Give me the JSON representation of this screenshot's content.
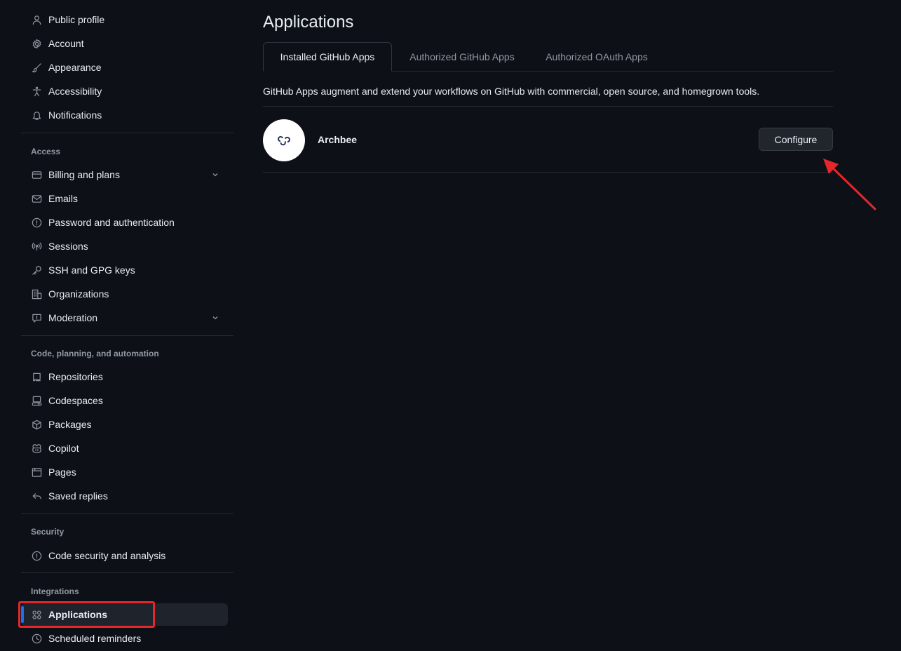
{
  "sidebar": {
    "items_top": [
      {
        "label": "Public profile",
        "icon": "person-icon"
      },
      {
        "label": "Account",
        "icon": "gear-icon"
      },
      {
        "label": "Appearance",
        "icon": "paintbrush-icon"
      },
      {
        "label": "Accessibility",
        "icon": "accessibility-icon"
      },
      {
        "label": "Notifications",
        "icon": "bell-icon"
      }
    ],
    "access": {
      "title": "Access",
      "items": [
        {
          "label": "Billing and plans",
          "icon": "credit-card-icon",
          "expandable": true
        },
        {
          "label": "Emails",
          "icon": "mail-icon"
        },
        {
          "label": "Password and authentication",
          "icon": "shield-lock-icon"
        },
        {
          "label": "Sessions",
          "icon": "broadcast-icon"
        },
        {
          "label": "SSH and GPG keys",
          "icon": "key-icon"
        },
        {
          "label": "Organizations",
          "icon": "organization-icon"
        },
        {
          "label": "Moderation",
          "icon": "report-icon",
          "expandable": true
        }
      ]
    },
    "code": {
      "title": "Code, planning, and automation",
      "items": [
        {
          "label": "Repositories",
          "icon": "repo-icon"
        },
        {
          "label": "Codespaces",
          "icon": "codespaces-icon"
        },
        {
          "label": "Packages",
          "icon": "package-icon"
        },
        {
          "label": "Copilot",
          "icon": "copilot-icon"
        },
        {
          "label": "Pages",
          "icon": "browser-icon"
        },
        {
          "label": "Saved replies",
          "icon": "reply-icon"
        }
      ]
    },
    "security": {
      "title": "Security",
      "items": [
        {
          "label": "Code security and analysis",
          "icon": "shield-icon"
        }
      ]
    },
    "integrations": {
      "title": "Integrations",
      "items": [
        {
          "label": "Applications",
          "icon": "apps-icon",
          "active": true
        },
        {
          "label": "Scheduled reminders",
          "icon": "clock-icon"
        }
      ]
    }
  },
  "main": {
    "title": "Applications",
    "tabs": [
      {
        "label": "Installed GitHub Apps",
        "selected": true
      },
      {
        "label": "Authorized GitHub Apps",
        "selected": false
      },
      {
        "label": "Authorized OAuth Apps",
        "selected": false
      }
    ],
    "description": "GitHub Apps augment and extend your workflows on GitHub with commercial, open source, and homegrown tools.",
    "apps": [
      {
        "name": "Archbee",
        "action_label": "Configure",
        "icon": "archbee-logo-icon"
      }
    ]
  },
  "annotations": {
    "highlight_color": "#e5262b",
    "arrow_color": "#e5262b"
  },
  "colors": {
    "background": "#0d1117",
    "text": "#e6edf3",
    "muted": "#9198a1",
    "accent": "#1f6feb"
  }
}
